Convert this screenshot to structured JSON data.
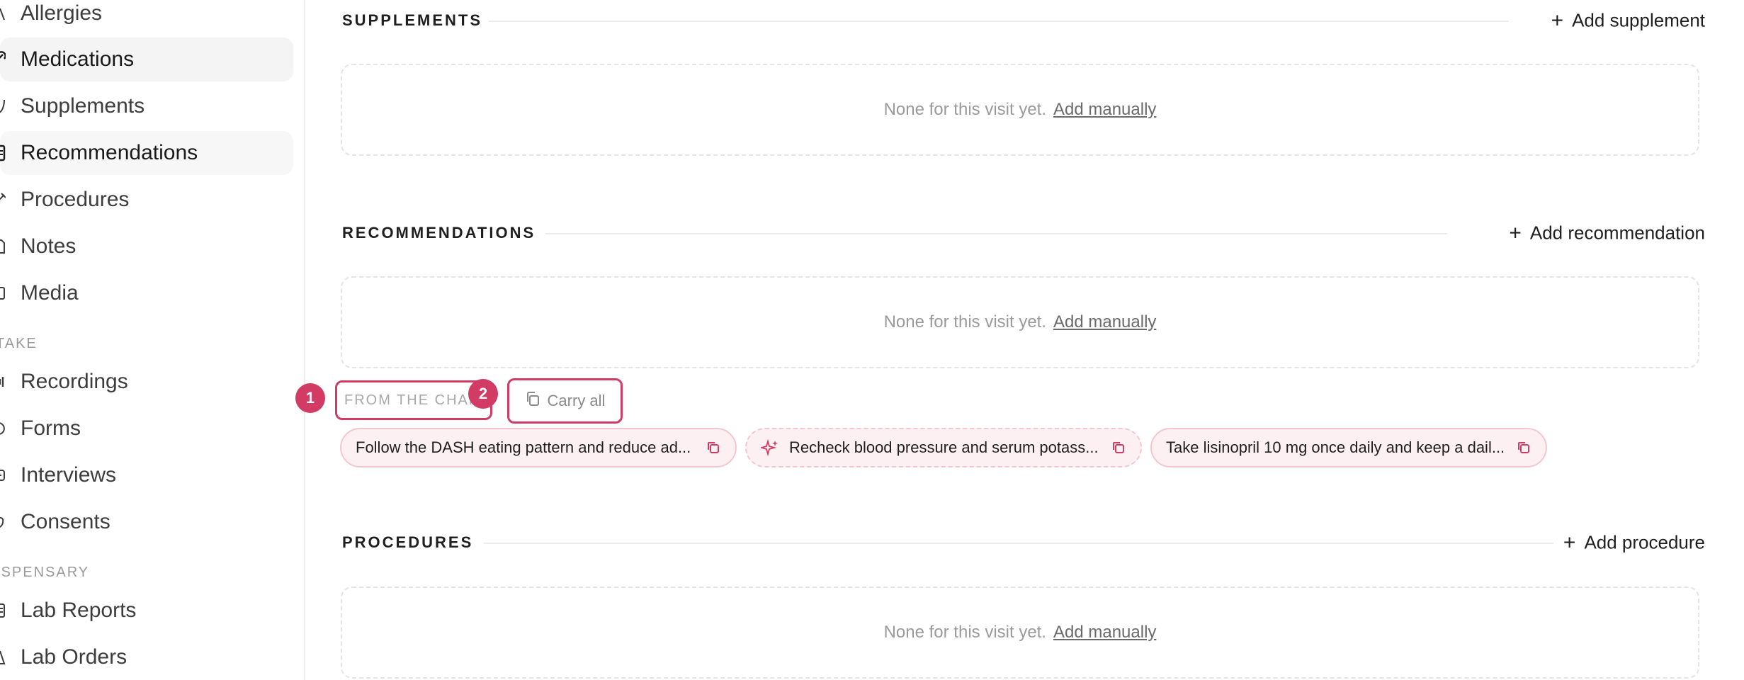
{
  "sidebar": {
    "items": [
      {
        "label": "Allergies",
        "icon": "allergy-icon"
      },
      {
        "label": "Medications",
        "icon": "pill-icon"
      },
      {
        "label": "Supplements",
        "icon": "leaf-icon"
      },
      {
        "label": "Recommendations",
        "icon": "clipboard-icon"
      },
      {
        "label": "Procedures",
        "icon": "syringe-icon"
      },
      {
        "label": "Notes",
        "icon": "note-icon"
      },
      {
        "label": "Media",
        "icon": "image-icon"
      },
      {
        "label": "Recordings",
        "icon": "waveform-icon"
      },
      {
        "label": "Forms",
        "icon": "form-icon"
      },
      {
        "label": "Interviews",
        "icon": "chat-icon"
      },
      {
        "label": "Consents",
        "icon": "signature-icon"
      },
      {
        "label": "Lab Reports",
        "icon": "report-icon"
      },
      {
        "label": "Lab Orders",
        "icon": "flask-icon"
      }
    ],
    "groups": {
      "intake": "TAKE",
      "dispensary": "ISPENSARY"
    }
  },
  "sections": {
    "supplements": {
      "title": "SUPPLEMENTS",
      "add_label": "Add supplement"
    },
    "recommendations": {
      "title": "RECOMMENDATIONS",
      "add_label": "Add recommendation"
    },
    "procedures": {
      "title": "PROCEDURES",
      "add_label": "Add procedure"
    }
  },
  "empty_state": {
    "text": "None for this visit yet.",
    "link": "Add manually"
  },
  "from_chart": {
    "label": "FROM THE CHART",
    "carry_all": "Carry all",
    "markers": [
      "1",
      "2"
    ],
    "chips": [
      "Follow the DASH eating pattern and reduce ad...",
      "Recheck blood pressure and serum potass...",
      "Take lisinopril 10 mg once daily and keep a dail..."
    ]
  },
  "colors": {
    "accent": "#d23c64",
    "chip_bg": "#fdf0f3",
    "chip_border": "#f3c6d1"
  }
}
